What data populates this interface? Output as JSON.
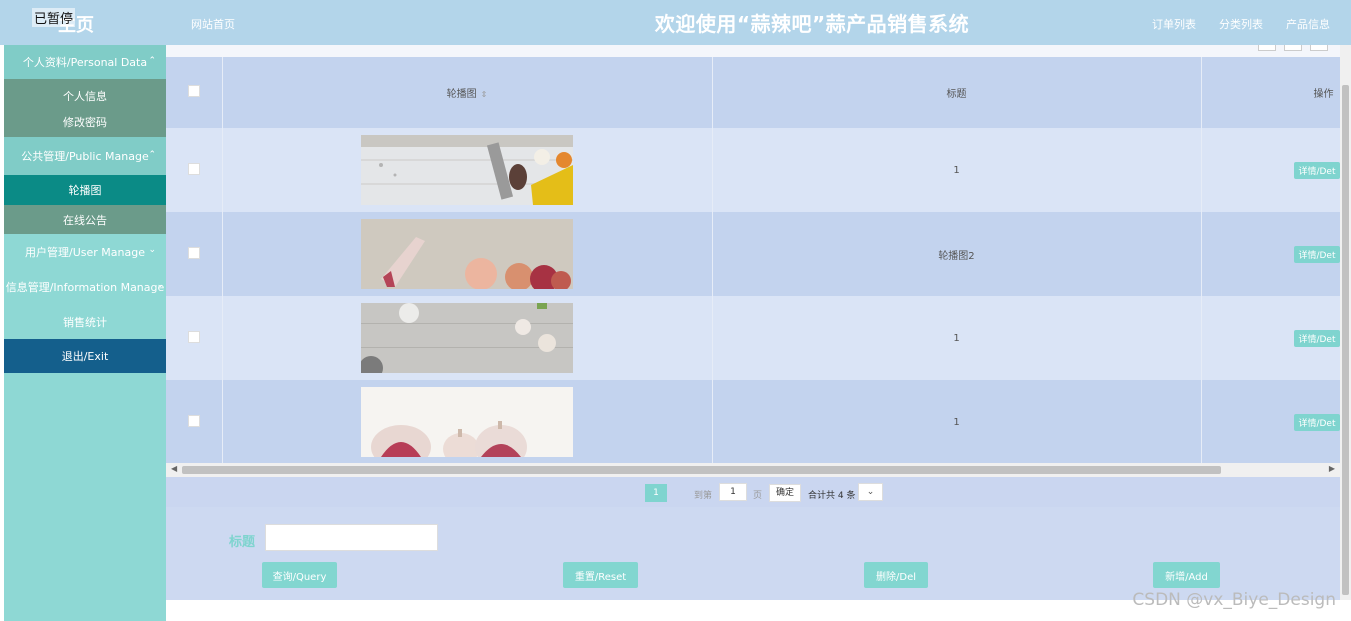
{
  "header": {
    "paused_label": "已暂停",
    "home_label": "主页",
    "site_home": "网站首页",
    "title": "欢迎使用“蒜辣吧”蒜产品销售系统",
    "links": [
      "订单列表",
      "分类列表",
      "产品信息"
    ]
  },
  "sidebar": {
    "groups": [
      {
        "label": "个人资料/Personal Data",
        "items": [
          "个人信息",
          "修改密码"
        ]
      },
      {
        "label": "公共管理/Public Manage",
        "items": [
          "轮播图",
          "在线公告"
        ]
      },
      {
        "label": "用户管理/User Manage"
      },
      {
        "label": "信息管理/Information Manage"
      },
      {
        "label": "销售统计"
      },
      {
        "label": "退出/Exit"
      }
    ],
    "active_item": "轮播图"
  },
  "table": {
    "columns": [
      "轮播图",
      "标题",
      "操作"
    ],
    "rows": [
      {
        "title": "1",
        "image": "spices-fork-oil",
        "action": "详情/Det"
      },
      {
        "title": "轮播图2",
        "image": "garlic-pomegranate",
        "action": "详情/Det"
      },
      {
        "title": "1",
        "image": "wood-garlic-bowl",
        "action": "详情/Det"
      },
      {
        "title": "1",
        "image": "garlic-bulbs",
        "action": "详情/Det"
      }
    ]
  },
  "pager": {
    "current_page": "1",
    "goto_label": "到第",
    "page_input": "1",
    "page_suffix": "页",
    "confirm": "确定",
    "total": "合计共 4 条"
  },
  "search": {
    "label": "标题",
    "value": "",
    "buttons": [
      "查询/Query",
      "重置/Reset",
      "删除/Del",
      "新增/Add"
    ]
  },
  "watermark": "CSDN @vx_Biye_Design",
  "colors": {
    "header": "#b3d5ea",
    "sidebar": "#8ed8d4",
    "accent": "#7fd4cf",
    "active": "#0b8b86",
    "exit": "#145f8c"
  }
}
